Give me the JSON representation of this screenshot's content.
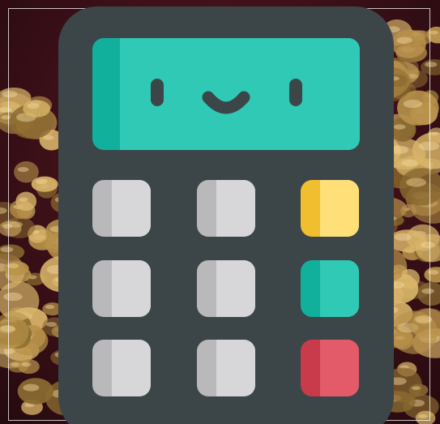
{
  "colors": {
    "background": "#3d1018",
    "coin_gold": "#b8924a",
    "body": "#3c4649",
    "screen_light": "#30c9b6",
    "screen_dark": "#10b09c",
    "face": "#3c4649",
    "key_gray_light": "#d7d6d8",
    "key_gray_dark": "#b9b8ba",
    "key_yellow_light": "#ffdf78",
    "key_yellow_dark": "#f0be2e",
    "key_teal_light": "#30c9b6",
    "key_teal_dark": "#10b09c",
    "key_red_light": "#e35b68",
    "key_red_dark": "#c93a4b",
    "frame_line": "#ffffff"
  },
  "icon": {
    "name": "calculator-icon",
    "screen_icon": "smiley-face-icon",
    "keypad": [
      [
        "gray",
        "gray",
        "yellow"
      ],
      [
        "gray",
        "gray",
        "teal"
      ],
      [
        "gray",
        "gray",
        "red"
      ]
    ]
  }
}
